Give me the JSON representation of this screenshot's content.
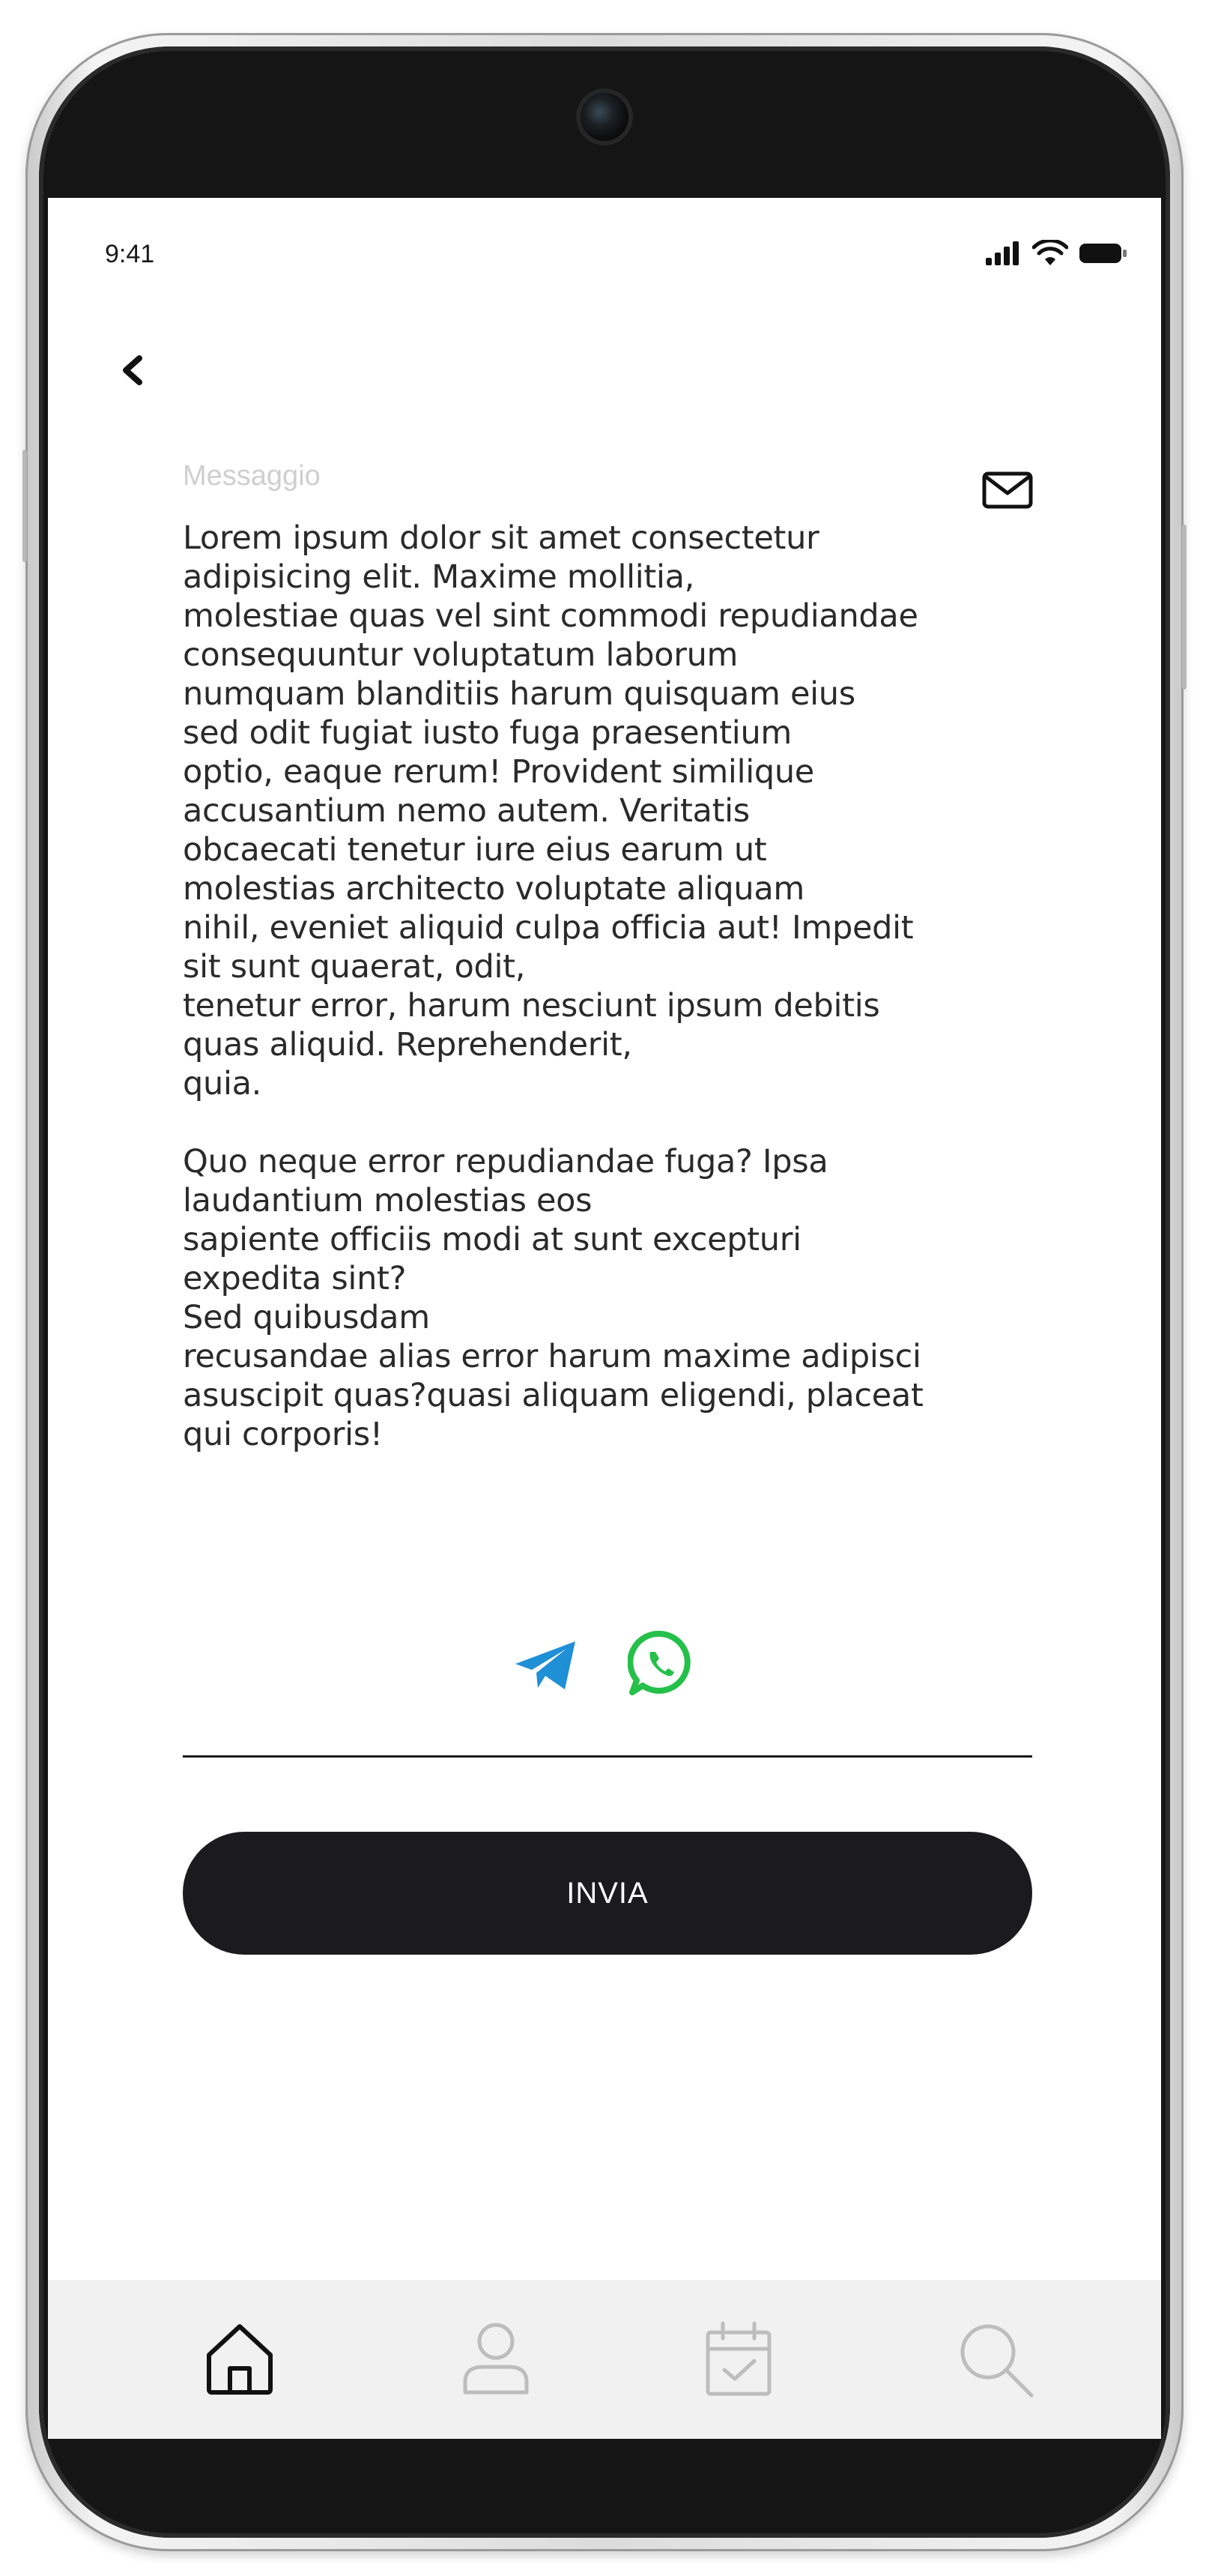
{
  "status_bar": {
    "time": "9:41"
  },
  "message": {
    "label": "Messaggio",
    "text": "Lorem ipsum dolor sit amet consectetur\nadipisicing elit. Maxime mollitia,\nmolestiae quas vel sint commodi repudiandae\nconsequuntur voluptatum laborum\nnumquam blanditiis harum quisquam eius\nsed odit fugiat iusto fuga praesentium\noptio, eaque rerum! Provident similique\naccusantium nemo autem. Veritatis\nobcaecati tenetur iure eius earum ut\nmolestias architecto voluptate aliquam\nnihil, eveniet aliquid culpa officia aut! Impedit\nsit sunt quaerat, odit,\ntenetur error, harum nesciunt ipsum debitis\nquas aliquid. Reprehenderit,\nquia.\n\nQuo neque error repudiandae fuga? Ipsa\nlaudantium molestias eos\nsapiente officiis modi at sunt excepturi\nexpedita sint?\nSed quibusdam\nrecusandae alias error harum maxime adipisci\nasuscipit quas?quasi aliquam eligendi, placeat\nqui corporis!"
  },
  "share": {
    "telegram_icon": "telegram-icon",
    "whatsapp_icon": "whatsapp-icon",
    "telegram_color": "#1f8fd6",
    "whatsapp_color": "#25c04a"
  },
  "send_button": {
    "label": "INVIA",
    "background": "#1b1b1d"
  },
  "bottom_nav": {
    "items": [
      {
        "icon": "home-icon",
        "active": true
      },
      {
        "icon": "user-icon",
        "active": false
      },
      {
        "icon": "calendar-check-icon",
        "active": false
      },
      {
        "icon": "search-icon",
        "active": false
      }
    ],
    "background": "#f1f1f1"
  }
}
